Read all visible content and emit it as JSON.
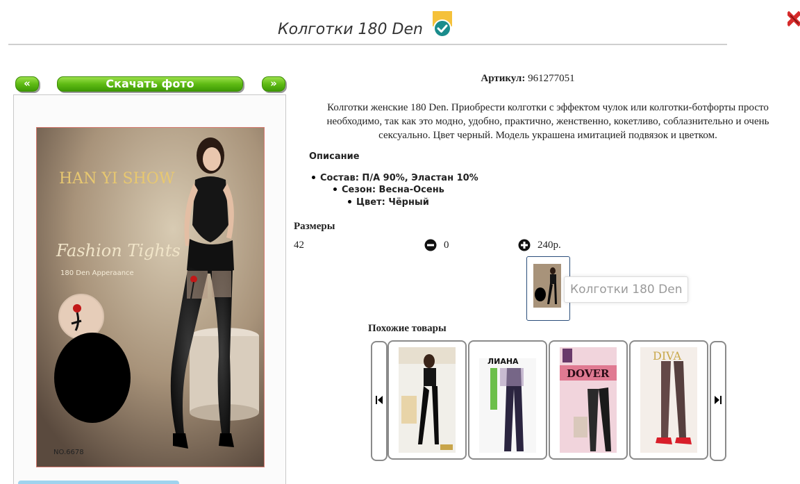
{
  "header": {
    "title": "Колготки 180 Den"
  },
  "gallery": {
    "prev_label": "«",
    "download_label": "Скачать фото",
    "next_label": "»",
    "photo": {
      "brand": "HAN YI SHOW",
      "script_text": "Fashion Tights",
      "subtitle": "180 Den Apperaance",
      "model_no": "NO.6678"
    }
  },
  "product": {
    "article_label": "Артикул:",
    "article_value": "961277051",
    "description": "Колготки женские 180 Den. Приобрести колготки с эффектом чулок или колготки-ботфорты просто необходимо, так как это модно, удобно, практично, женственно, кокетливо, соблазнительно и очень сексуально. Цвет черный. Модель украшена имитацией подвязок и цветком.",
    "desc_heading": "Описание",
    "properties": [
      "Состав: П/А 90%, Эластан 10%",
      "Сезон: Весна-Осень",
      "Цвет: Чёрный"
    ]
  },
  "sizes": {
    "heading": "Размеры",
    "rows": [
      {
        "size": "42",
        "qty": "0",
        "price": "240р."
      }
    ],
    "tooltip": "Колготки 180 Den"
  },
  "similar": {
    "heading": "Похожие товары",
    "items": [
      {
        "label": "",
        "brand_text": ""
      },
      {
        "label": "ЛИАНА",
        "brand_text": "ЛИАНА"
      },
      {
        "label": "DOVER",
        "brand_text": "DOVER"
      },
      {
        "label": "DIVA",
        "brand_text": "DIVA"
      }
    ]
  },
  "colors": {
    "accent_green": "#5fbb14",
    "verified_teal": "#1a8c8c",
    "verified_yellow": "#f5c13a",
    "close_red": "#d62b2b"
  },
  "icons": [
    "check-circle-icon",
    "close-icon",
    "minus-circle-icon",
    "plus-circle-icon",
    "first-page-icon",
    "last-page-icon"
  ]
}
